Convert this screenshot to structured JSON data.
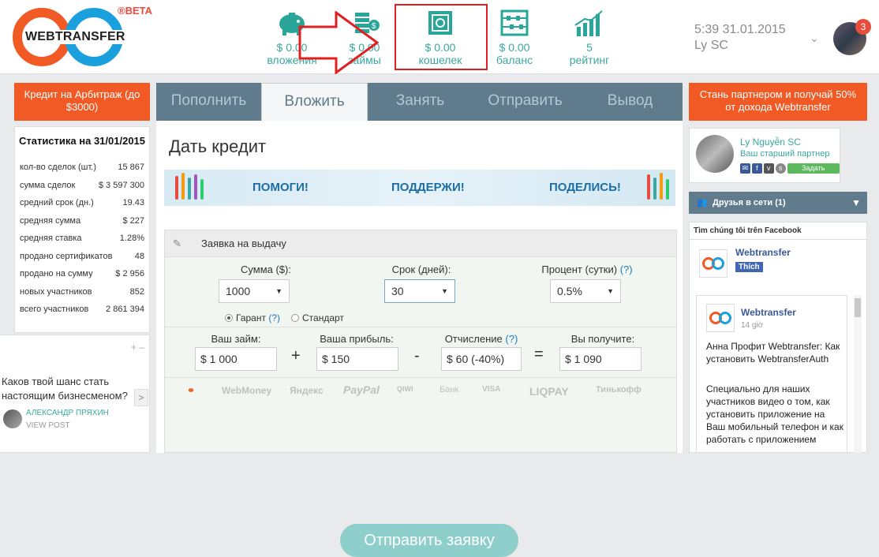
{
  "header": {
    "logo_text": "WEBTRANSFER",
    "beta": "®BETA",
    "stats": [
      {
        "value": "$ 0.00",
        "label": "вложения",
        "icon": "piggy-bank-icon"
      },
      {
        "value": "$ 0.00",
        "label": "займы",
        "icon": "coins-icon"
      },
      {
        "value": "$ 0.00",
        "label": "кошелек",
        "icon": "safe-icon"
      },
      {
        "value": "$ 0.00",
        "label": "баланс",
        "icon": "abacus-icon"
      },
      {
        "value": "5",
        "label": "рейтинг",
        "icon": "chart-growth-icon"
      }
    ],
    "datetime": "5:39 31.01.2015",
    "username": "Ly SC",
    "notifications": "3",
    "colors": {
      "accent": "#2aa59a",
      "highlight_border": "#e02020"
    }
  },
  "left_button": "Кредит на Арбитраж (до $3000)",
  "right_button": "Стань партнером и получай 50% от дохода Webtransfer",
  "tabs": [
    "Пополнить",
    "Вложить",
    "Занять",
    "Отправить",
    "Вывод"
  ],
  "stats_panel": {
    "title": "Статистика на 31/01/2015",
    "rows": [
      {
        "label": "кол-во сделок (шт.)",
        "value": "15 867"
      },
      {
        "label": "сумма сделок",
        "value": "$ 3 597 300"
      },
      {
        "label": "средний срок (дн.)",
        "value": "19.43"
      },
      {
        "label": "средняя сумма",
        "value": "$ 227"
      },
      {
        "label": "средняя ставка",
        "value": "1.28%"
      },
      {
        "label": "продано сертификатов",
        "value": "48"
      },
      {
        "label": "продано на сумму",
        "value": "$ 2 956"
      },
      {
        "label": "новых участников",
        "value": "852"
      },
      {
        "label": "всего участников",
        "value": "2 861 394"
      }
    ]
  },
  "popup": {
    "controls": "+ –",
    "question": "Каков твой шанс стать настоящим бизнесменом?",
    "next": ">",
    "author": "АЛЕКСАНДР ПРЯХИН",
    "view_post": "VIEW POST"
  },
  "main": {
    "title": "Дать кредит",
    "banner": [
      "ПОМОГИ!",
      "ПОДДЕРЖИ!",
      "ПОДЕЛИСЬ!"
    ],
    "form": {
      "header": "Заявка на выдачу",
      "amount_label": "Сумма ($):",
      "amount_value": "1000",
      "term_label": "Срок (дней):",
      "term_value": "30",
      "rate_label": "Процент (сутки)",
      "rate_hint": "(?)",
      "rate_value": "0.5%",
      "radio_guarantee": "Гарант",
      "radio_guarantee_hint": "(?)",
      "radio_standard": "Стандарт",
      "loan_label": "Ваш займ:",
      "loan_value": "$ 1 000",
      "profit_label": "Ваша прибыль:",
      "profit_value": "$ 150",
      "fee_label": "Отчисление",
      "fee_hint": "(?)",
      "fee_value": "$ 60 (-40%)",
      "receive_label": "Вы получите:",
      "receive_value": "$ 1 090",
      "plus": "+",
      "minus": "-",
      "equals": "=",
      "payments": [
        "WebMoney",
        "Яндекс",
        "PayPal",
        "QIWI",
        "Банк",
        "VISA",
        "LIQPAY",
        "Тинькофф"
      ],
      "submit": "Отправить заявку"
    }
  },
  "partner_card": {
    "name": "Ly Nguyễn SC",
    "subtitle": "Ваш старший партнер",
    "ask": "Задать вопрос"
  },
  "friends": {
    "label": "Друзья в сети (1)"
  },
  "facebook": {
    "title": "Tìm chúng tôi trên Facebook",
    "page_name": "Webtransfer",
    "like": "Thích",
    "post_name": "Webtransfer",
    "post_time": "14 giờ",
    "post_text_1": "Анна Профит Webtransfer: Как установить WebtransferAuth",
    "post_text_2": "Специально для наших участников видео о том, как установить приложение на Ваш мобильный телефон и как работать с приложением"
  }
}
